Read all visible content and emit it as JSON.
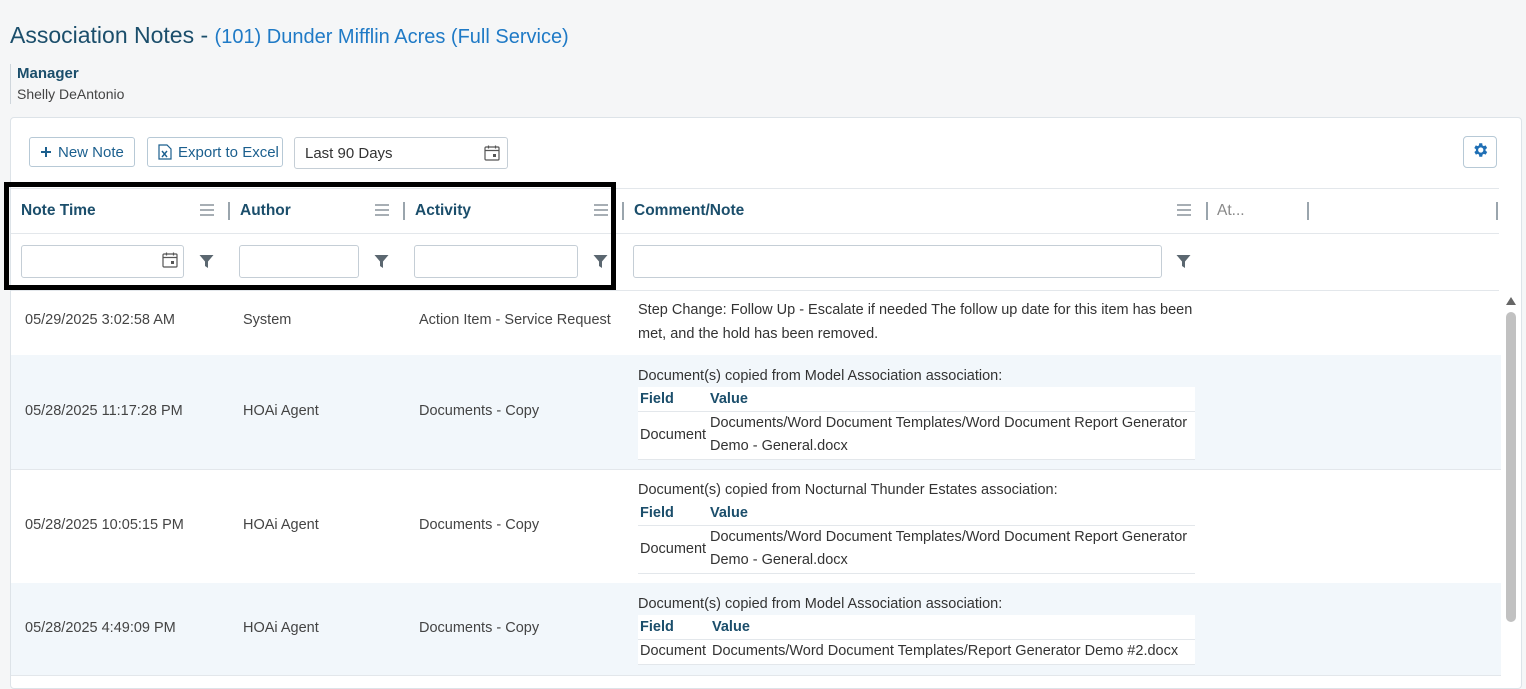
{
  "page": {
    "title": "Association Notes - ",
    "association": "(101) Dunder Mifflin Acres (Full Service)"
  },
  "manager": {
    "label": "Manager",
    "name": "Shelly DeAntonio"
  },
  "toolbar": {
    "new_note": "New Note",
    "export_excel": "Export to Excel",
    "date_range": "Last 90 Days"
  },
  "columns": {
    "note_time": "Note Time",
    "author": "Author",
    "activity": "Activity",
    "comment": "Comment/Note",
    "attachments": "At..."
  },
  "rows": [
    {
      "time": "05/29/2025 3:02:58 AM",
      "author": "System",
      "activity": "Action Item - Service Request",
      "comment_line1": "Step Change: Follow Up - Escalate if needed The follow up date for this item has been",
      "comment_line2": "met, and the hold has been removed."
    },
    {
      "time": "05/28/2025 11:17:28 PM",
      "author": "HOAi Agent",
      "activity": "Documents - Copy",
      "comment": "Document(s) copied from Model Association association:",
      "field_header": "Field",
      "value_header": "Value",
      "field": "Document",
      "value_line1": "Documents/Word Document Templates/Word Document Report Generator",
      "value_line2": "Demo - General.docx"
    },
    {
      "time": "05/28/2025 10:05:15 PM",
      "author": "HOAi Agent",
      "activity": "Documents - Copy",
      "comment": "Document(s) copied from Nocturnal Thunder Estates association:",
      "field_header": "Field",
      "value_header": "Value",
      "field": "Document",
      "value_line1": "Documents/Word Document Templates/Word Document Report Generator",
      "value_line2": "Demo - General.docx"
    },
    {
      "time": "05/28/2025 4:49:09 PM",
      "author": "HOAi Agent",
      "activity": "Documents - Copy",
      "comment": "Document(s) copied from Model Association association:",
      "field_header": "Field",
      "value_header": "Value",
      "field": "Document",
      "value_line1": "Documents/Word Document Templates/Report Generator Demo #2.docx"
    }
  ],
  "colors": {
    "accent": "#1f7ac6",
    "header_text": "#1b4e6b",
    "row_alt": "#f2f7fb"
  }
}
